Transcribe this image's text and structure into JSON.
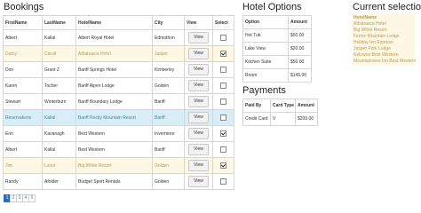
{
  "bookings": {
    "title": "Bookings",
    "headers": [
      "FirstName",
      "LastName",
      "HotelName",
      "City",
      "View",
      "Select"
    ],
    "view_label": "View",
    "rows": [
      {
        "first": "Albert",
        "last": "Kallal",
        "hotel": "Albert Royal Hotel",
        "city": "Edmothon",
        "selected": false,
        "state": "default"
      },
      {
        "first": "Darcy",
        "last": "Caroll",
        "hotel": "Athabasca Hotel",
        "city": "Jasper",
        "selected": true,
        "state": "selected"
      },
      {
        "first": "Don",
        "last": "Grant Z",
        "hotel": "Banff Springs Hotel",
        "city": "Kimberley",
        "selected": false,
        "state": "default"
      },
      {
        "first": "Karen",
        "last": "Tocher",
        "hotel": "Banff Alpen Lodge",
        "city": "Golden",
        "selected": false,
        "state": "default"
      },
      {
        "first": "Stewart",
        "last": "Winterburn",
        "hotel": "Banff Boundary Lodge",
        "city": "Banff",
        "selected": false,
        "state": "default"
      },
      {
        "first": "Reservations",
        "last": "Kallal",
        "hotel": "Banff Rocky Mountain Resort",
        "city": "Banff",
        "selected": false,
        "state": "info"
      },
      {
        "first": "Erin",
        "last": "Kavanagh",
        "hotel": "Best Western",
        "city": "Invermere",
        "selected": true,
        "state": "default"
      },
      {
        "first": "Albert",
        "last": "Kallal",
        "hotel": "Best Western",
        "city": "Banff",
        "selected": false,
        "state": "default"
      },
      {
        "first": "Jim",
        "last": "Lsout",
        "hotel": "Big White Resort",
        "city": "Golden",
        "selected": true,
        "state": "selected"
      },
      {
        "first": "Randy",
        "last": "Afolder",
        "hotel": "Budget Sport Rentals",
        "city": "Golden",
        "selected": false,
        "state": "default"
      }
    ],
    "pages": [
      "1",
      "2",
      "3",
      "4",
      "5"
    ],
    "active_page": "1"
  },
  "hotel_options": {
    "title": "Hotel Options",
    "headers": [
      "Option",
      "Amount"
    ],
    "rows": [
      {
        "option": "Hot Tub",
        "amount": "$50.00"
      },
      {
        "option": "Lake View",
        "amount": "$20.00"
      },
      {
        "option": "Kitchen Suite",
        "amount": "$50.00"
      },
      {
        "option": "Room",
        "amount": "$145.00"
      }
    ]
  },
  "payments": {
    "title": "Payments",
    "headers": [
      "Paid By",
      "Card Type",
      "Amount"
    ],
    "rows": [
      {
        "paid_by": "Credit Card",
        "card_type": "V",
        "amount": "$200.00"
      }
    ]
  },
  "current_selection": {
    "title": "Current selection",
    "header": "HotelName",
    "items": [
      "Athabasca Hotel",
      "Big White Resort",
      "Fernie Mountain Lodge",
      "Holiday Inn Express",
      "Jasper Park Lodge",
      "Kelowna Best Western",
      "Mountainview Inn Best Western"
    ]
  },
  "colors": {
    "selected_row_bg": "#fcf8e3",
    "selected_row_text": "#c09853",
    "info_row_bg": "#d9edf7",
    "info_row_text": "#3a87ad",
    "pager_active": "#2a6ebb"
  }
}
